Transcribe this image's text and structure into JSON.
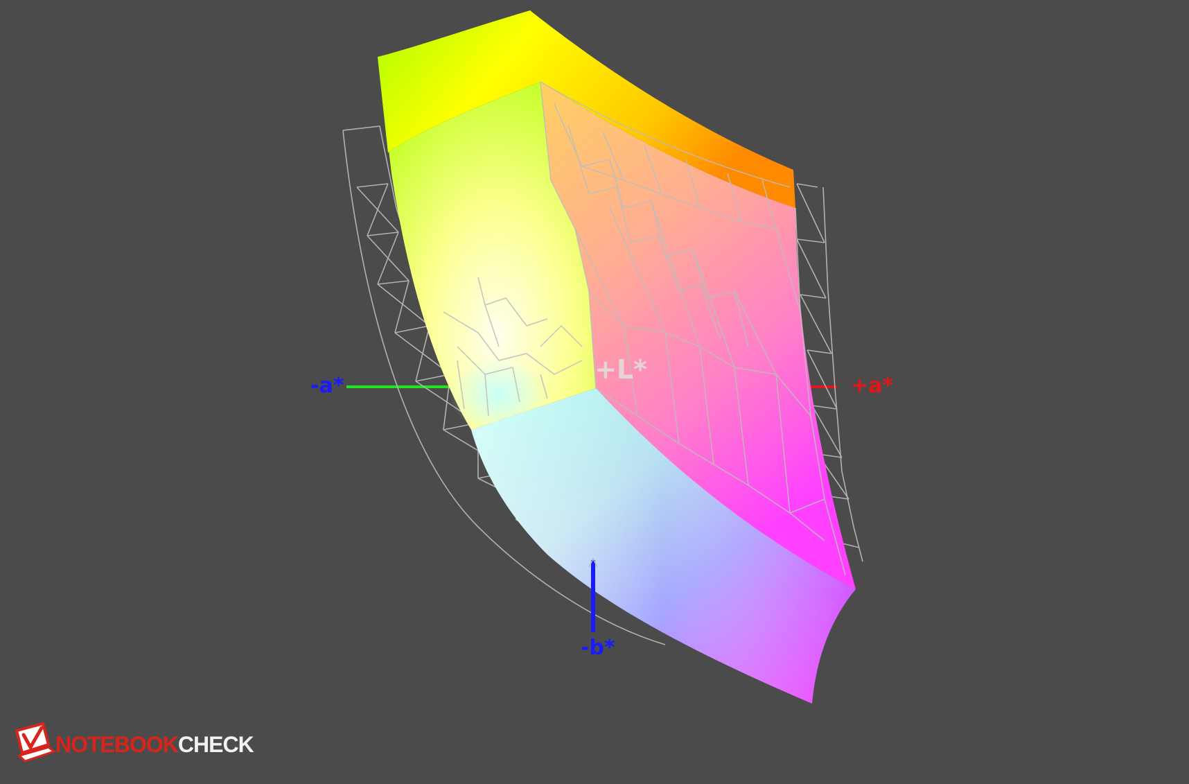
{
  "axes": {
    "neg_a": "-a*",
    "pos_a": "+a*",
    "neg_b": "-b*",
    "pos_l": "+L*"
  },
  "colors": {
    "background": "#4b4b4b",
    "neg_a_axis": "#22e322",
    "pos_a_axis": "#e01818",
    "b_axis": "#1a1aff",
    "wireframe": "#b8b8b8",
    "label_blue": "#1a1aff",
    "label_red": "#e01818",
    "brand_red": "#d9241c",
    "brand_text": "#f2f2f2"
  },
  "logo": {
    "part1": "NOTEBOOK",
    "part2": "CHECK",
    "icon": "notebookcheck-logo-icon"
  }
}
